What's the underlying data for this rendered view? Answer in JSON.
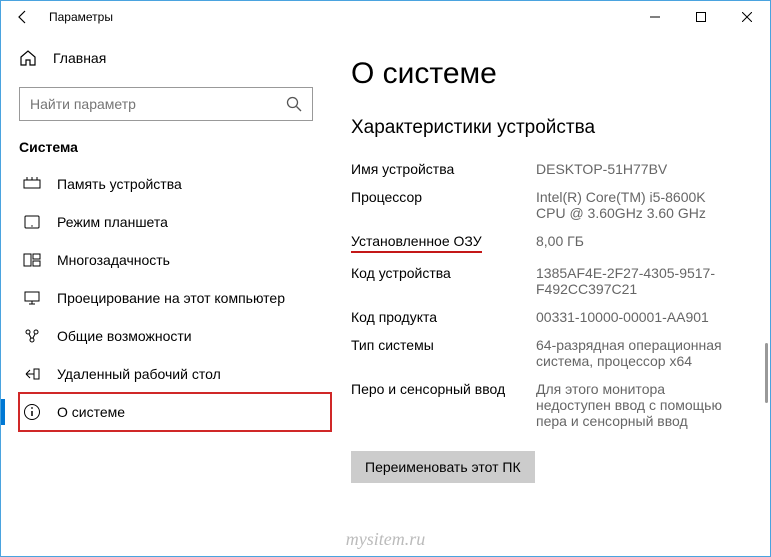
{
  "titlebar": {
    "title": "Параметры"
  },
  "home": {
    "label": "Главная"
  },
  "search": {
    "placeholder": "Найти параметр"
  },
  "section": {
    "title": "Система"
  },
  "nav": [
    {
      "id": "memory",
      "label": "Память устройства"
    },
    {
      "id": "tablet",
      "label": "Режим планшета"
    },
    {
      "id": "multitask",
      "label": "Многозадачность"
    },
    {
      "id": "project",
      "label": "Проецирование на этот компьютер"
    },
    {
      "id": "shared",
      "label": "Общие возможности"
    },
    {
      "id": "remote",
      "label": "Удаленный рабочий стол"
    },
    {
      "id": "about",
      "label": "О системе"
    }
  ],
  "page": {
    "title": "О системе",
    "device_heading": "Характеристики устройства",
    "specs": [
      {
        "label": "Имя устройства",
        "value": "DESKTOP-51H77BV"
      },
      {
        "label": "Процессор",
        "value": "Intel(R) Core(TM) i5-8600K CPU @ 3.60GHz   3.60 GHz"
      },
      {
        "label": "Установленное ОЗУ",
        "value": "8,00 ГБ",
        "highlight": true
      },
      {
        "label": "Код устройства",
        "value": "1385AF4E-2F27-4305-9517-F492CC397C21"
      },
      {
        "label": "Код продукта",
        "value": "00331-10000-00001-AA901"
      },
      {
        "label": "Тип системы",
        "value": "64-разрядная операционная система, процессор x64"
      },
      {
        "label": "Перо и сенсорный ввод",
        "value": "Для этого монитора недоступен ввод с помощью пера и сенсорный ввод"
      }
    ],
    "rename_btn": "Переименовать этот ПК"
  },
  "watermark": "mysitem.ru"
}
